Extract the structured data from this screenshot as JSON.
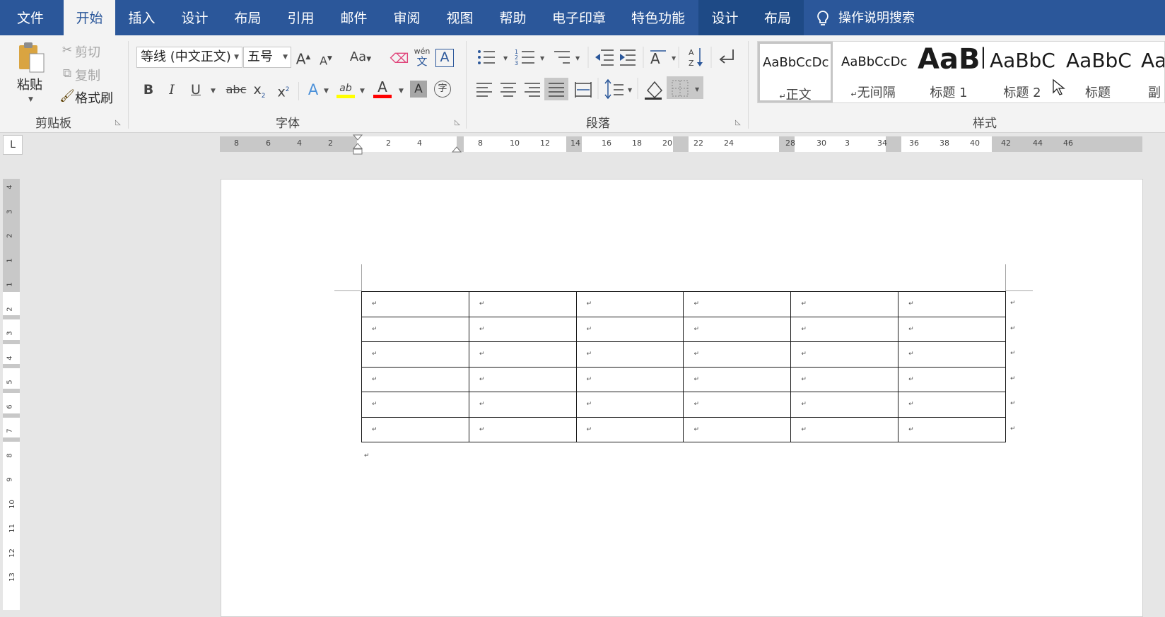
{
  "tabs": [
    "文件",
    "开始",
    "插入",
    "设计",
    "布局",
    "引用",
    "邮件",
    "审阅",
    "视图",
    "帮助",
    "电子印章",
    "特色功能",
    "设计",
    "布局"
  ],
  "active_tab": "开始",
  "search": {
    "label": "操作说明搜索",
    "icon": "lightbulb-icon"
  },
  "clipboard": {
    "paste": "粘贴",
    "cut": "剪切",
    "copy": "复制",
    "format_painter": "格式刷",
    "label": "剪贴板"
  },
  "font": {
    "name": "等线 (中文正文)",
    "size": "五号",
    "label": "字体",
    "change_case": "Aa",
    "bold": "B",
    "italic": "I",
    "underline": "U",
    "strike": "abc",
    "subscript": "x",
    "superscript": "x",
    "phonetic": "wén",
    "phonetic_base": "文",
    "highlight": "ab",
    "font_color": "A",
    "shading": "A",
    "enclose": "字",
    "grow": "A",
    "shrink": "A",
    "text_effect": "A",
    "border_char": "A",
    "highlight_color": "#ffff00",
    "font_color_value": "#ff0000"
  },
  "paragraph": {
    "label": "段落"
  },
  "styles": {
    "label": "样式",
    "items": [
      {
        "sample": "AaBbCcDc",
        "name": "正文",
        "mark": "↵"
      },
      {
        "sample": "AaBbCcDc",
        "name": "无间隔",
        "mark": "↵"
      },
      {
        "sample": "AaBl",
        "name": "标题 1"
      },
      {
        "sample": "AaBbC",
        "name": "标题 2"
      },
      {
        "sample": "AaBbC",
        "name": "标题"
      },
      {
        "sample": "Aa",
        "name": "副"
      }
    ]
  },
  "ruler": {
    "tab_selector": "L",
    "h_numbers": [
      "8",
      "6",
      "4",
      "2",
      "2",
      "4",
      "8",
      "10",
      "12",
      "14",
      "16",
      "18",
      "20",
      "22",
      "24",
      "28",
      "30",
      "3",
      "34",
      "36",
      "38",
      "40",
      "42",
      "44",
      "46"
    ],
    "v_numbers": [
      "4",
      "3",
      "2",
      "1",
      "1",
      "2",
      "3",
      "4",
      "5",
      "6",
      "7",
      "8",
      "9",
      "10",
      "11",
      "12",
      "13"
    ]
  },
  "document": {
    "rows": 6,
    "cols": 6,
    "cell_mark": "↵",
    "row_end_mark": "↵",
    "after_table_mark": "↵"
  },
  "colors": {
    "accent": "#2b579a",
    "ribbon_bg": "#f3f3f3",
    "canvas_bg": "#e6e6e6"
  }
}
